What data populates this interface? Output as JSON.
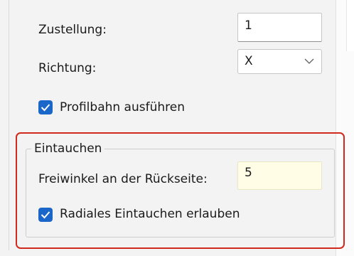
{
  "fields": {
    "zustellung_label": "Zustellung:",
    "zustellung_value": "1",
    "richtung_label": "Richtung:",
    "richtung_value": "X",
    "profilbahn_label": "Profilbahn ausführen",
    "profilbahn_checked": true
  },
  "eintauchen": {
    "title": "Eintauchen",
    "freiwinkel_label": "Freiwinkel an der Rückseite:",
    "freiwinkel_value": "5",
    "radiales_label": "Radiales Eintauchen erlauben",
    "radiales_checked": true
  },
  "colors": {
    "highlight": "#cf2a1b",
    "checkbox": "#1a66c9",
    "input_highlight": "#fffde6"
  },
  "icons": {
    "dropdown": "chevron-down-icon",
    "check": "checkmark-icon"
  }
}
